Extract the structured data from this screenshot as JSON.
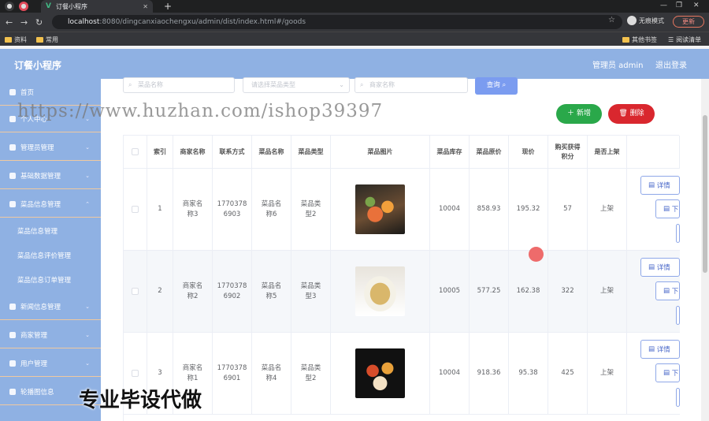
{
  "browser": {
    "tab_title": "订餐小程序",
    "url_host": "localhost",
    "url_path": ":8080/dingcanxiaochengxu/admin/dist/index.html#/goods",
    "incognito": "无痕模式",
    "update": "更新",
    "bookmarks": [
      "资料",
      "常用"
    ],
    "bookmarks_right": [
      "其他书签",
      "阅读清单"
    ]
  },
  "header": {
    "brand": "订餐小程序",
    "admin": "管理员 admin",
    "logout": "退出登录"
  },
  "sidebar": {
    "items": [
      {
        "label": "首页",
        "icon": "home-icon"
      },
      {
        "label": "个人中心",
        "icon": "user-icon"
      },
      {
        "label": "管理员管理",
        "icon": "admin-icon"
      },
      {
        "label": "基础数据管理",
        "icon": "data-icon"
      },
      {
        "label": "菜品信息管理",
        "icon": "dish-icon"
      },
      {
        "label": "新闻信息管理",
        "icon": "news-icon"
      },
      {
        "label": "商家管理",
        "icon": "shop-icon"
      },
      {
        "label": "用户管理",
        "icon": "users-icon"
      },
      {
        "label": "轮播图信息",
        "icon": "carousel-icon"
      }
    ],
    "subitems": [
      "菜品信息管理",
      "菜品信息评价管理",
      "菜品信息订单管理"
    ]
  },
  "filters": {
    "dish_name": "菜品名称",
    "dish_type": "请选择菜品类型",
    "merchant": "商家名称",
    "query": "查询"
  },
  "actions": {
    "add": "新增",
    "delete": "删除"
  },
  "table": {
    "headers": [
      "索引",
      "商家名称",
      "联系方式",
      "菜品名称",
      "菜品类型",
      "菜品图片",
      "菜品库存",
      "菜品原价",
      "现价",
      "购买获得积分",
      "是否上架"
    ],
    "rows": [
      {
        "index": "1",
        "merchant": "商家名称3",
        "phone": "17703786903",
        "dish": "菜品名称6",
        "type": "菜品类型2",
        "stock": "10004",
        "price": "858.93",
        "now": "195.32",
        "points": "57",
        "status": "上架"
      },
      {
        "index": "2",
        "merchant": "商家名称2",
        "phone": "17703786902",
        "dish": "菜品名称5",
        "type": "菜品类型3",
        "stock": "10005",
        "price": "577.25",
        "now": "162.38",
        "points": "322",
        "status": "上架"
      },
      {
        "index": "3",
        "merchant": "商家名称1",
        "phone": "17703786901",
        "dish": "菜品名称4",
        "type": "菜品类型2",
        "stock": "10004",
        "price": "918.36",
        "now": "95.38",
        "points": "425",
        "status": "上架"
      }
    ],
    "row_actions": {
      "detail": "详情",
      "down": "下"
    }
  },
  "overlay": {
    "url_watermark": "https://www.huzhan.com/ishop39397",
    "promo": "专业毕设代做"
  }
}
